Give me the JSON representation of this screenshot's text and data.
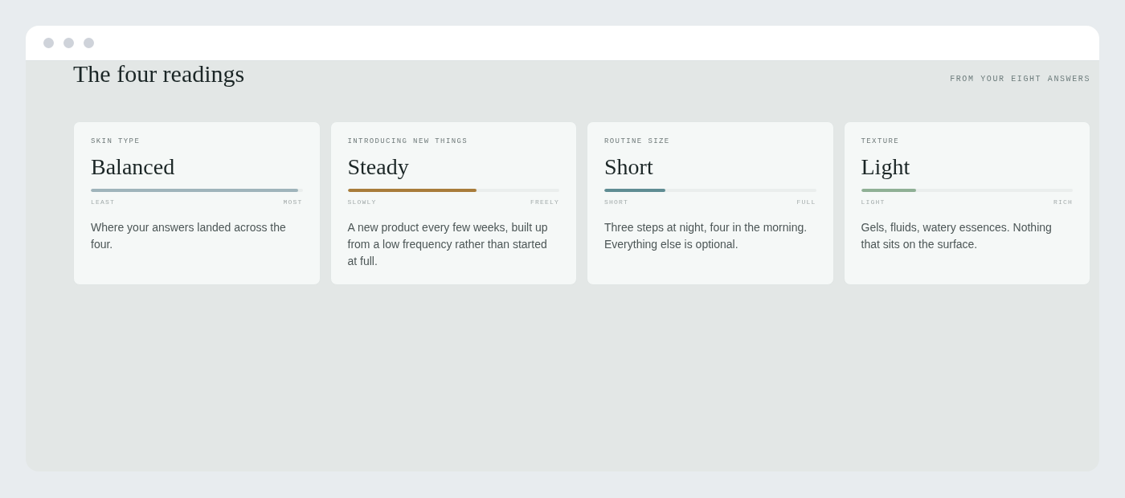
{
  "heading": {
    "title": "The four readings",
    "subtitle": "FROM YOUR EIGHT ANSWERS"
  },
  "readings": [
    {
      "label": "SKIN TYPE",
      "value": "Balanced",
      "level": 0.98,
      "color": "#9fb4bb",
      "low": "LEAST",
      "high": "MOST",
      "description": "Where your answers landed across the four."
    },
    {
      "label": "INTRODUCING NEW THINGS",
      "value": "Steady",
      "level": 0.61,
      "color": "#a87c3a",
      "low": "SLOWLY",
      "high": "FREELY",
      "description": "A new product every few weeks, built up from a low frequency rather than started at full."
    },
    {
      "label": "ROUTINE SIZE",
      "value": "Short",
      "level": 0.29,
      "color": "#5f8d93",
      "low": "SHORT",
      "high": "FULL",
      "description": "Three steps at night, four in the morning. Everything else is optional."
    },
    {
      "label": "TEXTURE",
      "value": "Light",
      "level": 0.26,
      "color": "#8fb095",
      "low": "LIGHT",
      "high": "RICH",
      "description": "Gels, fluids, watery essences. Nothing that sits on the surface."
    }
  ]
}
